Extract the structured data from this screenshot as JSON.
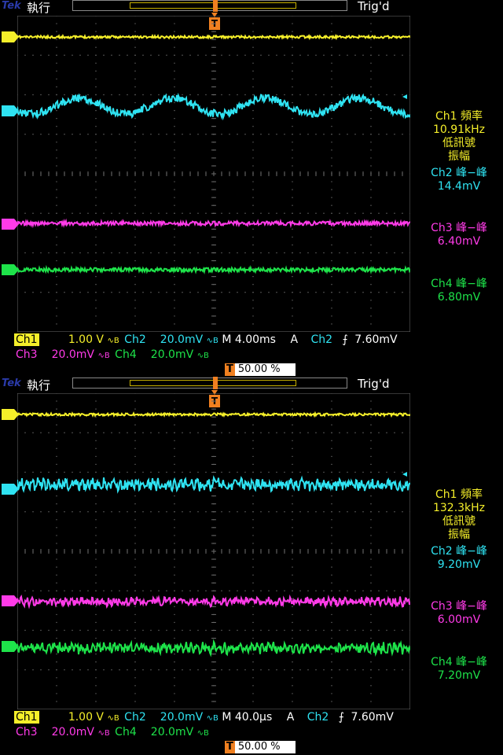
{
  "colors": {
    "ch1": "#f5ef2a",
    "ch2": "#2fe3f2",
    "ch3": "#ff3be8",
    "ch4": "#1ee34a",
    "grid": "#6b6b6b",
    "trigger_orange": "#f08020"
  },
  "screens": [
    {
      "brand": "Tek",
      "status": "執行",
      "trigger_state": "Trig'd",
      "channels": {
        "ch1_label": "1",
        "ch2_label": "2",
        "ch3_label": "3",
        "ch4_label": "4"
      },
      "measurements": {
        "ch1_title": "Ch1 頻率",
        "ch1_value": "10.91kHz",
        "ch1_note1": "低訊號",
        "ch1_note2": "振幅",
        "ch2_title": "Ch2 峰−峰",
        "ch2_value": "14.4mV",
        "ch3_title": "Ch3 峰−峰",
        "ch3_value": "6.40mV",
        "ch4_title": "Ch4 峰−峰",
        "ch4_value": "6.80mV"
      },
      "bottom": {
        "ch1_name": "Ch1",
        "ch1_scale": "1.00 V",
        "ch2_name": "Ch2",
        "ch2_scale": "20.0mV",
        "timebase": "M 4.00ms",
        "trig_mode": "A",
        "trig_ch": "Ch2",
        "trig_level": "7.60mV",
        "ch3_name": "Ch3",
        "ch3_scale": "20.0mV",
        "ch4_name": "Ch4",
        "ch4_scale": "20.0mV",
        "pos": "50.00 %"
      },
      "waveforms": {
        "ch2_type": "sine",
        "ch2_cycles": 4.2,
        "ch2_amp_fraction": 0.5,
        "ch2_noise": 0.35
      }
    },
    {
      "brand": "Tek",
      "status": "執行",
      "trigger_state": "Trig'd",
      "channels": {
        "ch1_label": "1",
        "ch2_label": "2",
        "ch3_label": "3",
        "ch4_label": "4"
      },
      "measurements": {
        "ch1_title": "Ch1 頻率",
        "ch1_value": "132.3kHz",
        "ch1_note1": "低訊號",
        "ch1_note2": "振幅",
        "ch2_title": "Ch2 峰−峰",
        "ch2_value": "9.20mV",
        "ch3_title": "Ch3 峰−峰",
        "ch3_value": "6.00mV",
        "ch4_title": "Ch4 峰−峰",
        "ch4_value": "7.20mV"
      },
      "bottom": {
        "ch1_name": "Ch1",
        "ch1_scale": "1.00 V",
        "ch2_name": "Ch2",
        "ch2_scale": "20.0mV",
        "timebase": "M 40.0µs",
        "trig_mode": "A",
        "trig_ch": "Ch2",
        "trig_level": "7.60mV",
        "ch3_name": "Ch3",
        "ch3_scale": "20.0mV",
        "ch4_name": "Ch4",
        "ch4_scale": "20.0mV",
        "pos": "50.00 %"
      },
      "waveforms": {
        "ch2_type": "noise",
        "ch2_cycles": 0,
        "ch2_amp_fraction": 0.25,
        "ch2_noise": 0.9
      }
    }
  ]
}
